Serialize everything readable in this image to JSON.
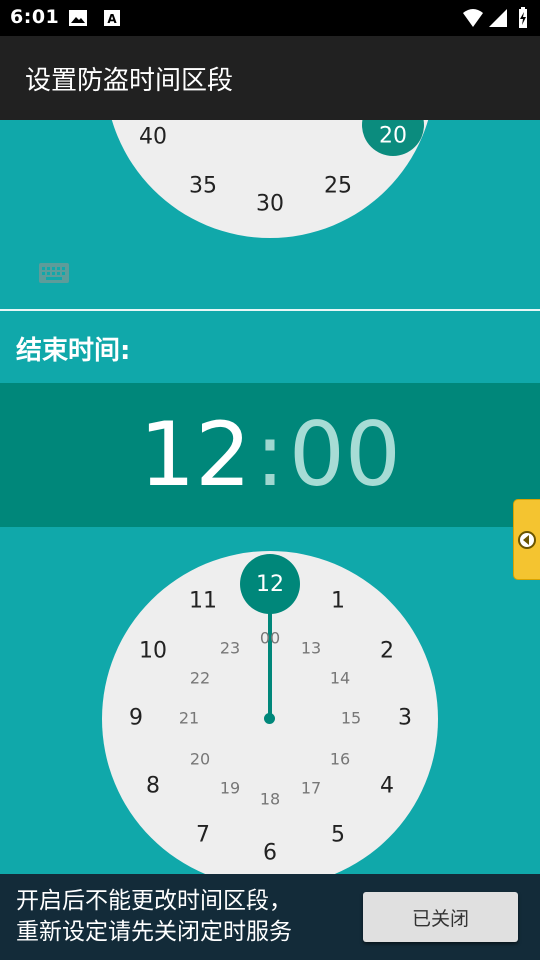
{
  "status_bar": {
    "time": "6:01"
  },
  "app_bar": {
    "title": "设置防盗时间区段"
  },
  "start_dial": {
    "numbers": [
      "40",
      "35",
      "30",
      "25"
    ],
    "selected": "20"
  },
  "end_section": {
    "label": "结束时间:",
    "hour": "12",
    "separator": ":",
    "minute": "00"
  },
  "end_dial": {
    "outer_hours": [
      "12",
      "1",
      "2",
      "3",
      "4",
      "5",
      "6",
      "7",
      "8",
      "9",
      "10",
      "11"
    ],
    "inner_hours": [
      "00",
      "13",
      "14",
      "15",
      "16",
      "17",
      "18",
      "19",
      "20",
      "21",
      "22",
      "23"
    ],
    "selected": "12"
  },
  "bottom_bar": {
    "line1": "开启后不能更改时间区段，",
    "line2": "重新设定请先关闭定时服务",
    "button_label": "已关闭"
  },
  "colors": {
    "background_teal": "#10A8AA",
    "header_teal": "#00877A",
    "app_bar": "#212121",
    "bottom_bar": "#132B39"
  }
}
